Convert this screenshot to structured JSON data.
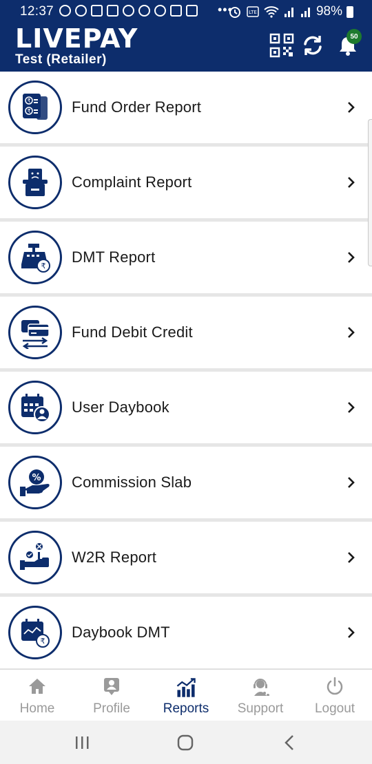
{
  "status_bar": {
    "time": "12:37",
    "dots": "•••",
    "battery": "98%"
  },
  "header": {
    "brand": "LIVEPAY",
    "subtitle": "Test (Retailer)",
    "notification_count": "50",
    "icons": [
      "qr-code-icon",
      "sync-icon",
      "bell-icon"
    ]
  },
  "reports": [
    {
      "label": "Fund Order Report",
      "icon": "fund-order-icon"
    },
    {
      "label": "Complaint Report",
      "icon": "complaint-icon"
    },
    {
      "label": "DMT Report",
      "icon": "dmt-icon"
    },
    {
      "label": "Fund Debit Credit",
      "icon": "debit-credit-icon"
    },
    {
      "label": "User Daybook",
      "icon": "user-daybook-icon"
    },
    {
      "label": "Commission Slab",
      "icon": "commission-icon"
    },
    {
      "label": "W2R Report",
      "icon": "w2r-icon"
    },
    {
      "label": "Daybook DMT",
      "icon": "daybook-dmt-icon"
    }
  ],
  "bottom_nav": [
    {
      "label": "Home",
      "icon": "home-icon",
      "active": false
    },
    {
      "label": "Profile",
      "icon": "profile-icon",
      "active": false
    },
    {
      "label": "Reports",
      "icon": "reports-icon",
      "active": true
    },
    {
      "label": "Support",
      "icon": "support-icon",
      "active": false
    },
    {
      "label": "Logout",
      "icon": "power-icon",
      "active": false
    }
  ],
  "colors": {
    "primary": "#0d2d6c",
    "badge": "#1e7a2e",
    "inactive": "#9a9a9a"
  }
}
